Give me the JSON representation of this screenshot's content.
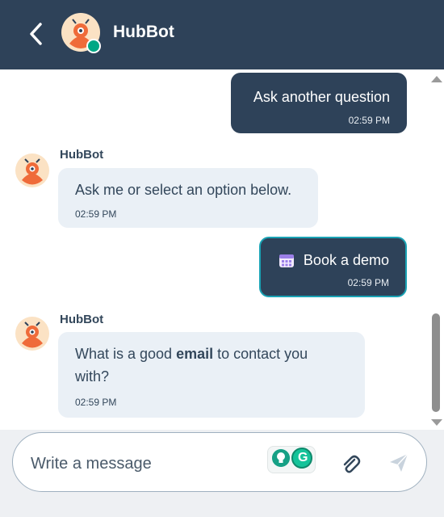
{
  "header": {
    "title": "HubBot"
  },
  "messages": [
    {
      "from": "user",
      "text": "Ask another question",
      "time": "02:59 PM"
    },
    {
      "from": "bot",
      "sender": "HubBot",
      "text": "Ask me or select an option below.",
      "time": "02:59 PM"
    },
    {
      "from": "user",
      "text": "Book a demo",
      "time": "02:59 PM",
      "icon": "calendar-icon"
    },
    {
      "from": "bot",
      "sender": "HubBot",
      "text_before": "What is a good ",
      "text_bold": "email",
      "text_after": " to contact you",
      "text_line2": "with?",
      "time": "02:59 PM"
    }
  ],
  "composer": {
    "placeholder": "Write a message"
  },
  "colors": {
    "header": "#2e4259",
    "bot_bubble": "#eaf0f6",
    "online": "#00a785",
    "selected_border": "#1aa3b5"
  }
}
